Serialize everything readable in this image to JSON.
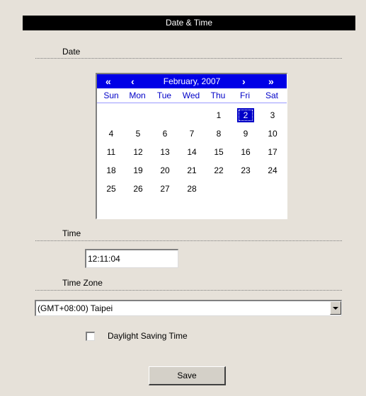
{
  "title": "Date & Time",
  "date_section": {
    "label": "Date"
  },
  "calendar": {
    "month_title": "February, 2007",
    "nav": {
      "prev_year": "«",
      "prev_month": "‹",
      "next_month": "›",
      "next_year": "»"
    },
    "weekdays": [
      "Sun",
      "Mon",
      "Tue",
      "Wed",
      "Thu",
      "Fri",
      "Sat"
    ],
    "weeks": [
      [
        "",
        "",
        "",
        "",
        "1",
        "2",
        "3"
      ],
      [
        "4",
        "5",
        "6",
        "7",
        "8",
        "9",
        "10"
      ],
      [
        "11",
        "12",
        "13",
        "14",
        "15",
        "16",
        "17"
      ],
      [
        "18",
        "19",
        "20",
        "21",
        "22",
        "23",
        "24"
      ],
      [
        "25",
        "26",
        "27",
        "28",
        "",
        "",
        ""
      ]
    ],
    "selected_day": "2",
    "colors": {
      "header_bg": "#0000e6",
      "selected_bg": "#0000c8",
      "weekday_text": "#0000c8"
    }
  },
  "time_section": {
    "label": "Time",
    "value": "12:11:04"
  },
  "timezone_section": {
    "label": "Time Zone",
    "selected": "(GMT+08:00) Taipei"
  },
  "daylight_saving": {
    "label": "Daylight Saving Time",
    "checked": false
  },
  "save_button": {
    "label": "Save"
  }
}
